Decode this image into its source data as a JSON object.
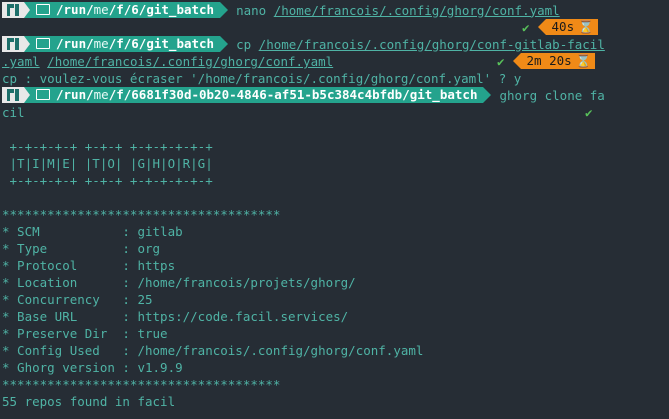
{
  "prompts": [
    {
      "path_dim": "/run/",
      "path_mid": "me",
      "path_sep": "/f/6/",
      "path_bold": "git_batch",
      "command": "nano",
      "args": "/home/francois/.config/ghorg/conf.yaml",
      "duration": "40s"
    },
    {
      "path_dim": "/run/",
      "path_mid": "me",
      "path_sep": "/f/6/",
      "path_bold": "git_batch",
      "command": "cp",
      "args1": "/home/francois/.config/ghorg/conf-gitlab-facil",
      "args2": ".yaml",
      "args3": "/home/francois/.config/ghorg/conf.yaml",
      "duration": "2m 20s"
    },
    {
      "path_dim": "/run/",
      "path_mid": "me",
      "path_sep": "/f/6681f30d-0b20-4846-af51-b5c384c4bfdb/",
      "path_bold": "git_batch",
      "command": "ghorg clone fa",
      "wrap": "cil"
    }
  ],
  "overwrite_prompt": "cp : voulez-vous écraser '/home/francois/.config/ghorg/conf.yaml' ? y",
  "check_mark": "✔",
  "hourglass": "⌛",
  "banner": [
    " +-+-+-+-+ +-+-+ +-+-+-+-+-+",
    " |T|I|M|E| |T|O| |G|H|O|R|G|",
    " +-+-+-+-+ +-+-+ +-+-+-+-+-+"
  ],
  "stars": "*************************************",
  "config": [
    "* SCM           : gitlab",
    "* Type          : org",
    "* Protocol      : https",
    "* Location      : /home/francois/projets/ghorg/",
    "* Concurrency   : 25",
    "* Base URL      : https://code.facil.services/",
    "* Preserve Dir  : true",
    "* Config Used   : /home/francois/.config/ghorg/conf.yaml",
    "* Ghorg version : v1.9.9"
  ],
  "result": "55 repos found in facil"
}
